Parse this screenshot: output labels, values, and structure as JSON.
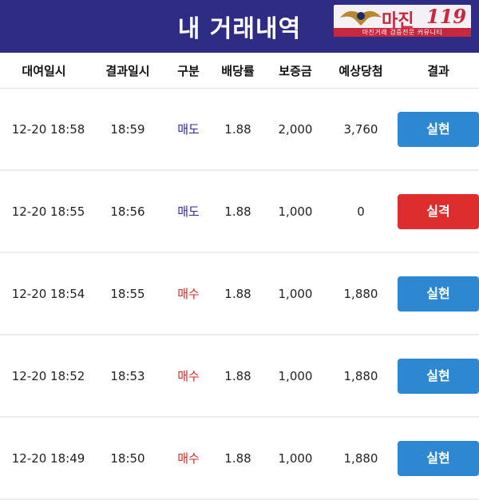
{
  "header": {
    "title": "내 거래내역",
    "logo": {
      "brand": "마진",
      "number": "119",
      "tagline": "마진거래 검증전문 커뮤니티"
    }
  },
  "columns": [
    "대여일시",
    "결과일시",
    "구분",
    "배당률",
    "보증금",
    "예상당첨",
    "결과"
  ],
  "rows": [
    {
      "start": "12-20 18:58",
      "end": "18:59",
      "type": "매도",
      "odds": "1.88",
      "deposit": "2,000",
      "expected": "3,760",
      "result": "실현"
    },
    {
      "start": "12-20 18:55",
      "end": "18:56",
      "type": "매도",
      "odds": "1.88",
      "deposit": "1,000",
      "expected": "0",
      "result": "실격"
    },
    {
      "start": "12-20 18:54",
      "end": "18:55",
      "type": "매수",
      "odds": "1.88",
      "deposit": "1,000",
      "expected": "1,880",
      "result": "실현"
    },
    {
      "start": "12-20 18:52",
      "end": "18:53",
      "type": "매수",
      "odds": "1.88",
      "deposit": "1,000",
      "expected": "1,880",
      "result": "실현"
    },
    {
      "start": "12-20 18:49",
      "end": "18:50",
      "type": "매수",
      "odds": "1.88",
      "deposit": "1,000",
      "expected": "1,880",
      "result": "실현"
    }
  ],
  "colors": {
    "header_bg": "#2f2c86",
    "sell_text": "#2b2a9a",
    "buy_text": "#d32a2a",
    "win_button": "#2e87d1",
    "lose_button": "#dd2d2d"
  }
}
